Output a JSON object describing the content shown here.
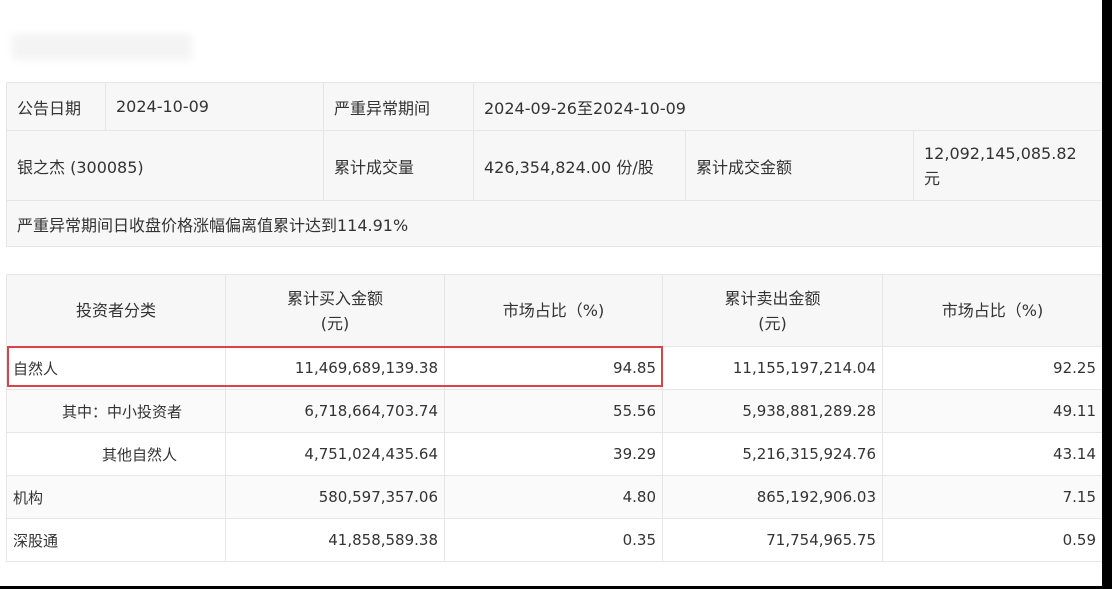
{
  "info": {
    "announce_date_label": "公告日期",
    "announce_date_value": "2024-10-09",
    "period_label": "严重异常期间",
    "period_value": "2024-09-26至2024-10-09",
    "stock_name": "银之杰 (300085)",
    "volume_label": "累计成交量",
    "volume_value": "426,354,824.00 份/股",
    "amount_label": "累计成交金额",
    "amount_value": "12,092,145,085.82 元",
    "deviation_note": "严重异常期间日收盘价格涨幅偏离值累计达到114.91%"
  },
  "stats": {
    "headers": [
      "投资者分类",
      "累计买入金额\n(元)",
      "市场占比（%)",
      "累计卖出金额\n(元)",
      "市场占比（%)"
    ],
    "rows": [
      {
        "category": "自然人",
        "buy": "11,469,689,139.38",
        "buy_pct": "94.85",
        "sell": "11,155,197,214.04",
        "sell_pct": "92.25"
      },
      {
        "category": "其中：中小投资者",
        "buy": "6,718,664,703.74",
        "buy_pct": "55.56",
        "sell": "5,938,881,289.28",
        "sell_pct": "49.11"
      },
      {
        "category": "其他自然人",
        "buy": "4,751,024,435.64",
        "buy_pct": "39.29",
        "sell": "5,216,315,924.76",
        "sell_pct": "43.14"
      },
      {
        "category": "机构",
        "buy": "580,597,357.06",
        "buy_pct": "4.80",
        "sell": "865,192,906.03",
        "sell_pct": "7.15"
      },
      {
        "category": "深股通",
        "buy": "41,858,589.38",
        "buy_pct": "0.35",
        "sell": "71,754,965.75",
        "sell_pct": "0.59"
      }
    ]
  },
  "colors": {
    "highlight": "#d9444b",
    "header_bg": "#f7f7f7",
    "border": "#e6e6e6"
  }
}
